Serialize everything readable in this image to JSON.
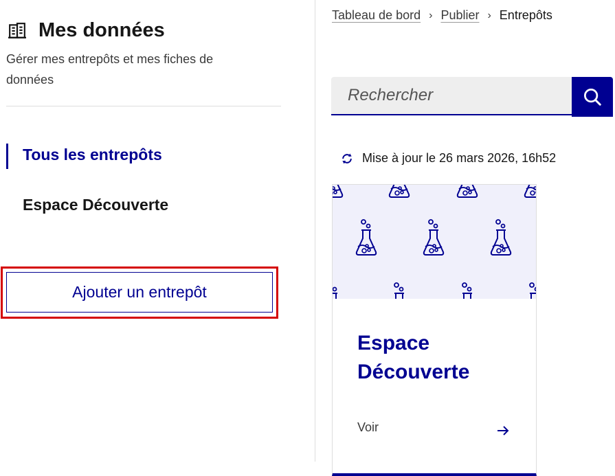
{
  "sidebar": {
    "title": "Mes données",
    "title_icon": "building-icon",
    "description": "Gérer mes entrepôts et mes fiches de données",
    "nav": [
      {
        "label": "Tous les entrepôts",
        "active": true
      },
      {
        "label": "Espace Découverte",
        "active": false
      }
    ],
    "add_button": "Ajouter un entrepôt"
  },
  "breadcrumb": {
    "items": [
      "Tableau de bord",
      "Publier"
    ],
    "current": "Entrepôts",
    "separator_icon": "chevron-right-icon"
  },
  "search": {
    "placeholder": "Rechercher",
    "button_icon": "search-icon"
  },
  "update": {
    "icon": "refresh-icon",
    "text": "Mise à jour le 26 mars 2026, 16h52"
  },
  "card": {
    "image_icon": "flask-pattern-icon",
    "title": "Espace Découverte",
    "link": "Voir",
    "arrow_icon": "arrow-right-icon"
  },
  "colors": {
    "primary": "#000091",
    "highlight": "#d40000",
    "search_bg": "#eeeeee",
    "card_image_bg": "#f0f0fb"
  }
}
